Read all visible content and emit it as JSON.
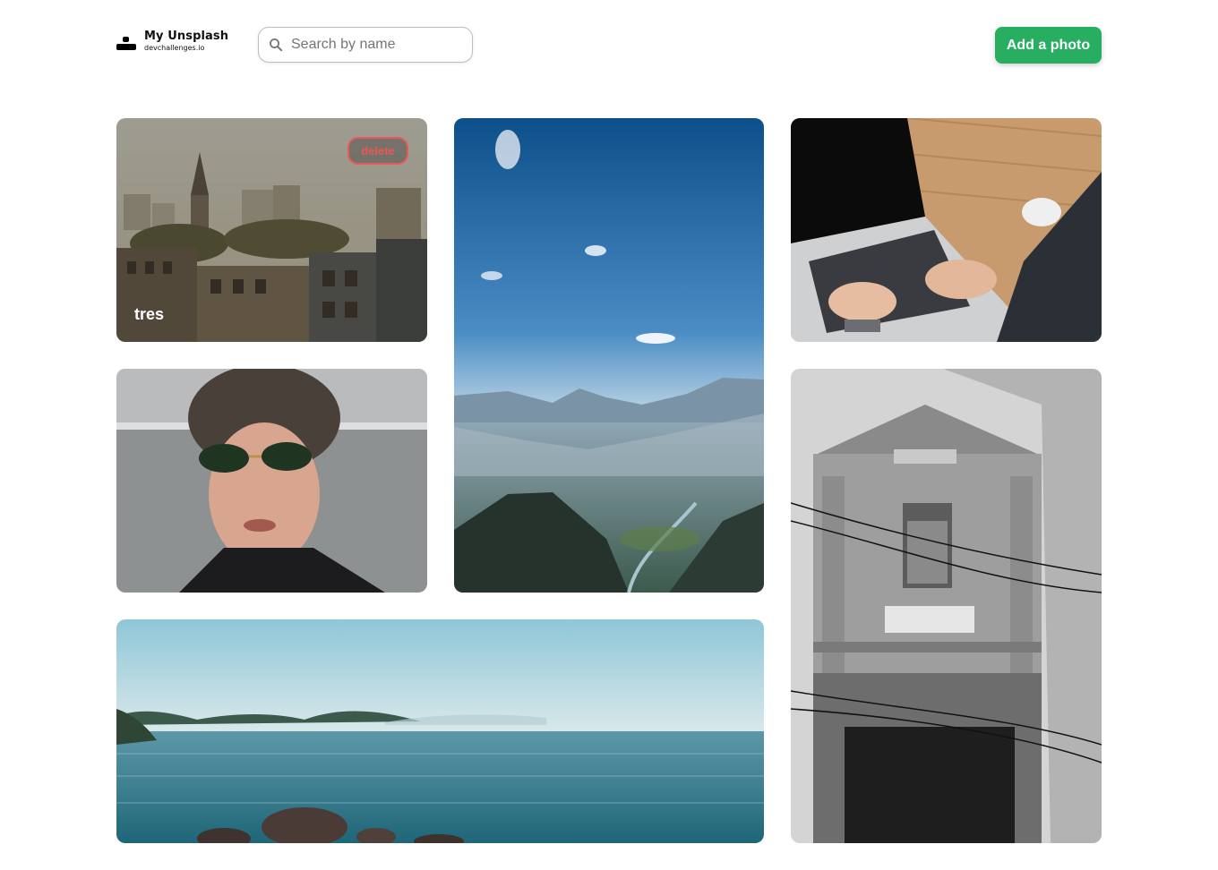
{
  "header": {
    "logo_title": "My Unsplash",
    "logo_subtitle": "devchallenges.io",
    "search_placeholder": "Search by name",
    "add_button_label": "Add a photo"
  },
  "colors": {
    "accent_green": "#27ae60",
    "delete_red": "#eb5757"
  },
  "photos": [
    {
      "label": "tres",
      "delete_label": "delete",
      "subject": "city rooftops with church spire",
      "hovered": true
    },
    {
      "subject": "mountain valley under blue sky"
    },
    {
      "subject": "hands typing on laptop"
    },
    {
      "subject": "man with curly wig and sunglasses"
    },
    {
      "subject": "black and white old building facade"
    },
    {
      "subject": "sea with islands and rocks"
    }
  ]
}
